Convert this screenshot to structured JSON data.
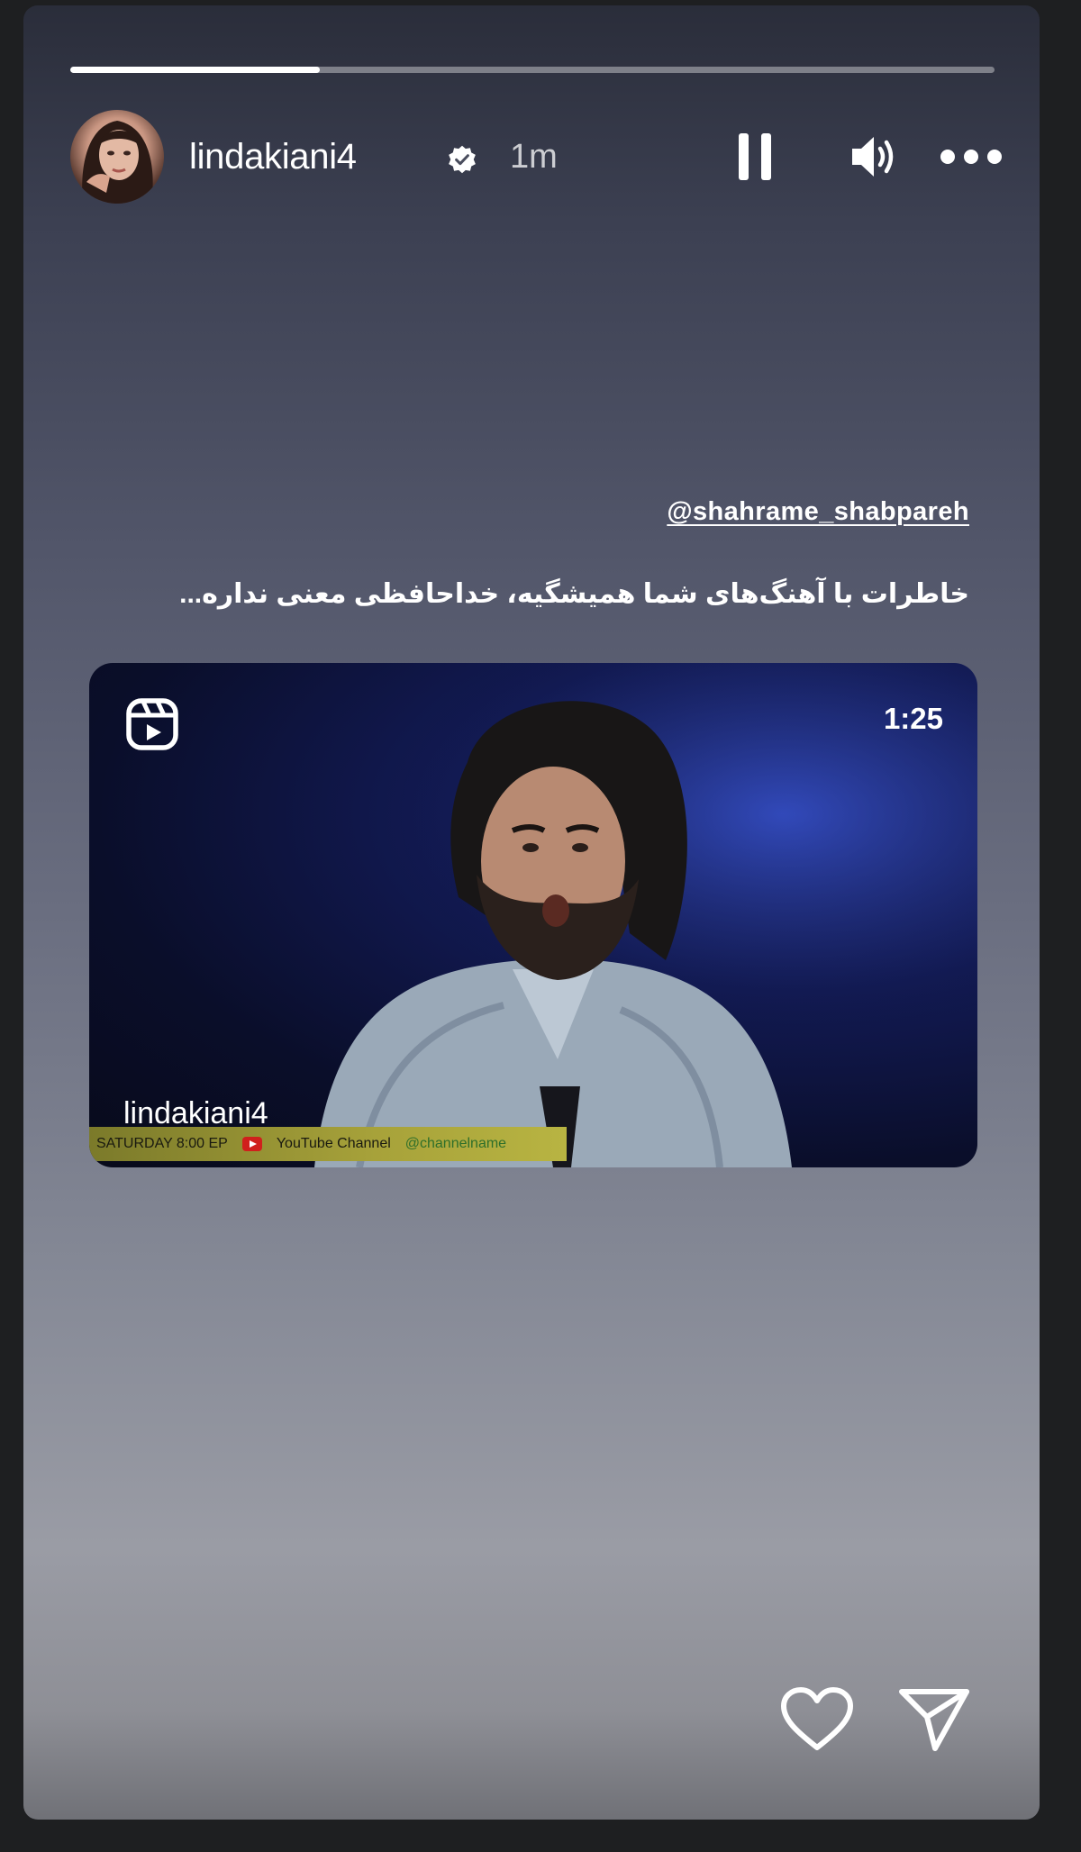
{
  "story": {
    "progress_fraction": 0.27,
    "author": {
      "username": "lindakiani4",
      "verified": true,
      "posted_ago": "1m"
    },
    "controls": {
      "pause_icon": "pause-icon",
      "mute_icon": "speaker-icon",
      "more_icon": "more-dots-icon"
    },
    "mention": "@shahrame_shabpareh",
    "caption": "خاطرات با آهنگ‌های شما همیشگیه، خداحافظی معنی نداره...",
    "video": {
      "duration": "1:25",
      "watermark": "lindakiani4",
      "ticker_left": "SATURDAY 8:00 EP",
      "ticker_mid": "YouTube Channel",
      "ticker_right": "@channelname"
    },
    "actions": {
      "like_icon": "heart-icon",
      "share_icon": "send-icon"
    }
  },
  "colors": {
    "background": "#1e1f21",
    "text": "#ffffff",
    "progress_track": "rgba(255,255,255,0.38)",
    "progress_fill": "#ffffff"
  }
}
